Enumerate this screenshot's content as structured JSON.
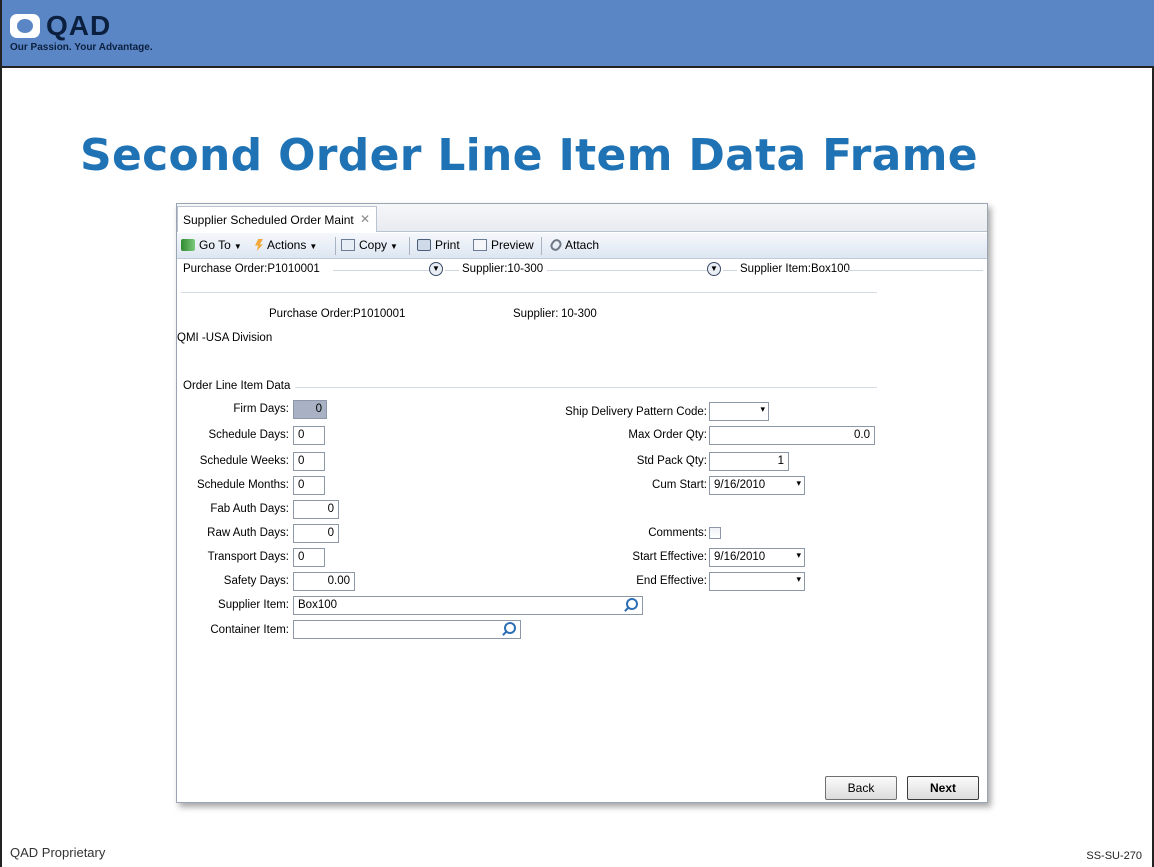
{
  "brand": {
    "name": "QAD",
    "tagline": "Our Passion. Your Advantage."
  },
  "slide": {
    "title": "Second Order Line Item Data Frame",
    "footer_left": "QAD Proprietary",
    "footer_right": "SS-SU-270"
  },
  "window": {
    "tab_label": "Supplier Scheduled Order Maint",
    "tab_close": "✕",
    "toolbar": {
      "goto": "Go To",
      "actions": "Actions",
      "copy": "Copy",
      "print": "Print",
      "preview": "Preview",
      "attach": "Attach"
    },
    "breadcrumbs": [
      "Purchase Order:P1010001",
      "Supplier:10-300",
      "Supplier Item:Box100"
    ]
  },
  "header": {
    "po_label": "Purchase Order:",
    "po_value": "P1010001",
    "supplier_label": "Supplier:",
    "supplier_value": "10-300",
    "division": "QMI -USA Division"
  },
  "section": {
    "title": "Order Line Item Data"
  },
  "left_fields": [
    {
      "label": "Firm Days:",
      "value": "0"
    },
    {
      "label": "Schedule Days:",
      "value": "0"
    },
    {
      "label": "Schedule Weeks:",
      "value": "0"
    },
    {
      "label": "Schedule Months:",
      "value": "0"
    },
    {
      "label": "Fab Auth Days:",
      "value": "0"
    },
    {
      "label": "Raw Auth Days:",
      "value": "0"
    },
    {
      "label": "Transport Days:",
      "value": "0"
    },
    {
      "label": "Safety Days:",
      "value": "0.00"
    }
  ],
  "right_fields": {
    "ship_pattern": {
      "label": "Ship Delivery Pattern Code:",
      "value": ""
    },
    "max_order_qty": {
      "label": "Max Order Qty:",
      "value": "0.0"
    },
    "std_pack_qty": {
      "label": "Std Pack Qty:",
      "value": "1"
    },
    "cum_start": {
      "label": "Cum Start:",
      "value": "9/16/2010"
    },
    "comments": {
      "label": "Comments:",
      "checked": false
    },
    "start_effective": {
      "label": "Start Effective:",
      "value": "9/16/2010"
    },
    "end_effective": {
      "label": "End Effective:",
      "value": ""
    }
  },
  "items": {
    "supplier_item": {
      "label": "Supplier Item:",
      "value": "Box100"
    },
    "container_item": {
      "label": "Container Item:",
      "value": ""
    }
  },
  "buttons": {
    "back": "Back",
    "next": "Next"
  },
  "icons": {
    "dropdown": "▾",
    "expand": "⌄",
    "close": "✕"
  }
}
